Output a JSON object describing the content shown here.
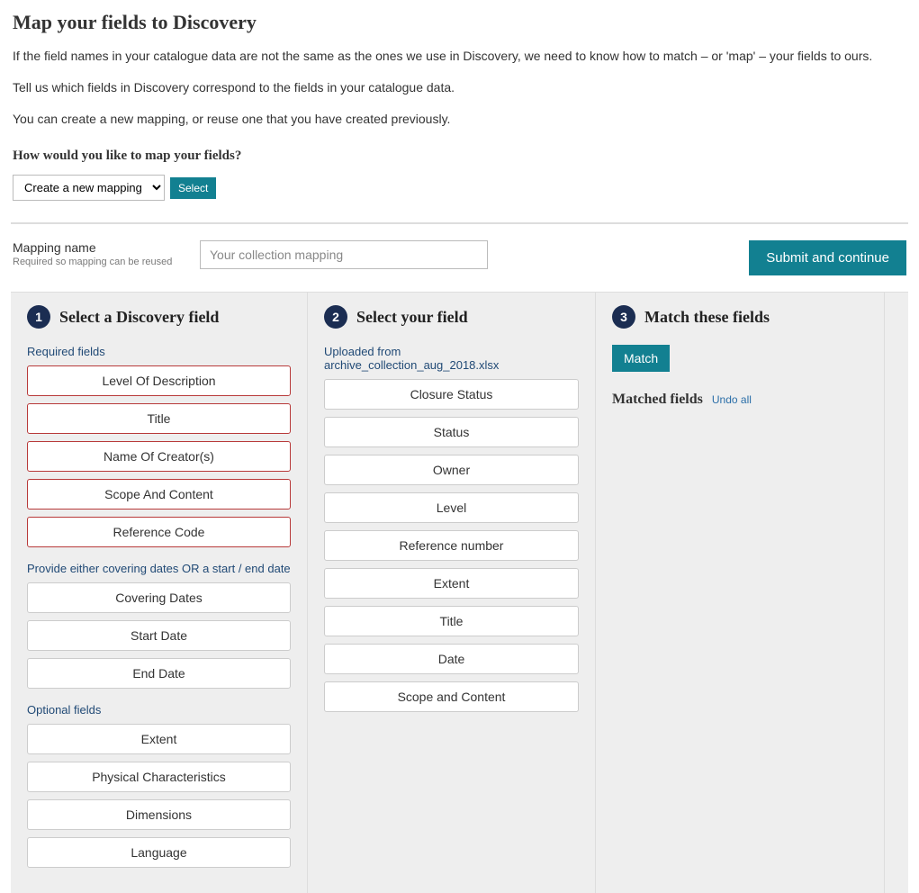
{
  "header": {
    "title": "Map your fields to Discovery",
    "para1": "If the field names in your catalogue data are not the same as the ones we use in Discovery, we need to know how to match – or 'map' – your fields to ours.",
    "para2": "Tell us which fields in Discovery correspond to the fields in your catalogue data.",
    "para3": "You can create a new mapping, or reuse one that you have created previously."
  },
  "map_choice": {
    "question": "How would you like to map your fields?",
    "option": "Create a new mapping",
    "select_btn": "Select"
  },
  "mapping_name": {
    "label": "Mapping name",
    "sub": "Required so mapping can be reused",
    "placeholder": "Your collection mapping"
  },
  "submit_btn": "Submit and continue",
  "col1": {
    "num": "1",
    "title": "Select a Discovery field",
    "required_label": "Required fields",
    "required": [
      "Level Of Description",
      "Title",
      "Name Of Creator(s)",
      "Scope And Content",
      "Reference Code"
    ],
    "dates_label": "Provide either covering dates OR a start / end date",
    "dates": [
      "Covering Dates",
      "Start Date",
      "End Date"
    ],
    "optional_label": "Optional fields",
    "optional": [
      "Extent",
      "Physical Characteristics",
      "Dimensions",
      "Language"
    ]
  },
  "col2": {
    "num": "2",
    "title": "Select your field",
    "uploaded_label": "Uploaded from archive_collection_aug_2018.xlsx",
    "fields": [
      "Closure Status",
      "Status",
      "Owner",
      "Level",
      "Reference number",
      "Extent",
      "Title",
      "Date",
      "Scope and Content"
    ]
  },
  "col3": {
    "num": "3",
    "title": "Match these fields",
    "match_btn": "Match",
    "matched_label": "Matched fields",
    "undo": "Undo all"
  }
}
